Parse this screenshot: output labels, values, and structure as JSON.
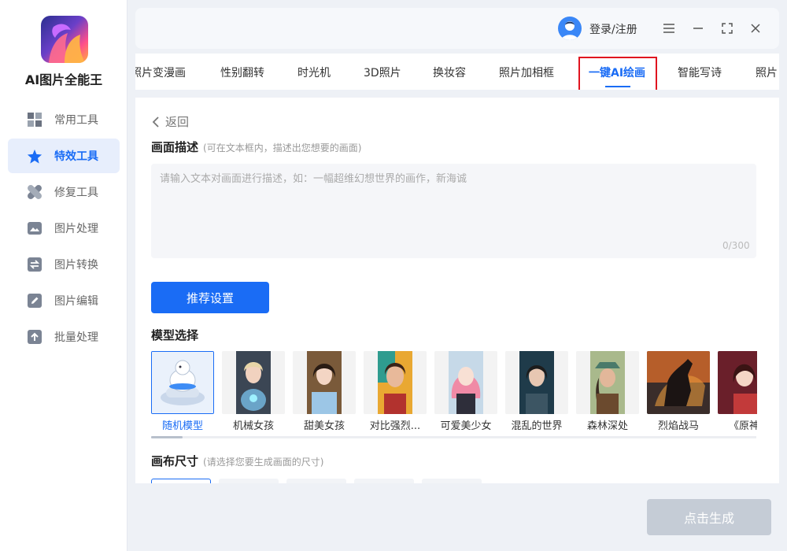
{
  "app": {
    "name": "AI图片全能王"
  },
  "colors": {
    "accent": "#1a6cf5",
    "highlight": "#e0141f",
    "disabled": "#c5ccd6"
  },
  "sidebar": {
    "items": [
      {
        "label": "常用工具",
        "icon": "grid-icon"
      },
      {
        "label": "特效工具",
        "icon": "star-icon",
        "active": true
      },
      {
        "label": "修复工具",
        "icon": "bandage-icon"
      },
      {
        "label": "图片处理",
        "icon": "image-icon"
      },
      {
        "label": "图片转换",
        "icon": "swap-icon"
      },
      {
        "label": "图片编辑",
        "icon": "edit-icon"
      },
      {
        "label": "批量处理",
        "icon": "upload-icon"
      }
    ]
  },
  "header": {
    "login_label": "登录/注册"
  },
  "tabs": [
    {
      "label": "照片变漫画"
    },
    {
      "label": "性别翻转"
    },
    {
      "label": "时光机"
    },
    {
      "label": "3D照片"
    },
    {
      "label": "换妆容"
    },
    {
      "label": "照片加相框"
    },
    {
      "label": "一键AI绘画",
      "active": true
    },
    {
      "label": "智能写诗"
    },
    {
      "label": "照片"
    }
  ],
  "content": {
    "back_label": "返回",
    "description": {
      "title": "画面描述",
      "hint": "(可在文本框内，描述出您想要的画面)",
      "placeholder": "请输入文本对画面进行描述，如：一幅超维幻想世界的画作，新海诚",
      "value": "",
      "counter": "0/300"
    },
    "recommend_label": "推荐设置",
    "model_section": {
      "title": "模型选择",
      "models": [
        {
          "label": "随机模型",
          "active": true
        },
        {
          "label": "机械女孩"
        },
        {
          "label": "甜美女孩"
        },
        {
          "label": "对比强烈..."
        },
        {
          "label": "可爱美少女"
        },
        {
          "label": "混乱的世界"
        },
        {
          "label": "森林深处"
        },
        {
          "label": "烈焰战马"
        },
        {
          "label": "《原神》"
        }
      ]
    },
    "canvas_section": {
      "title": "画布尺寸",
      "hint": "(请选择您要生成画面的尺寸)"
    }
  },
  "generate_label": "点击生成"
}
